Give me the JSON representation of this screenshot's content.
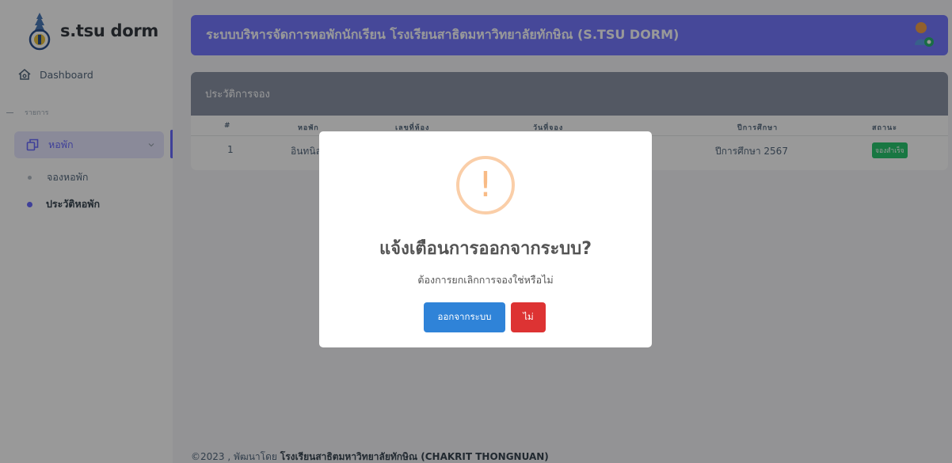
{
  "sidebar": {
    "brand": "s.tsu dorm",
    "dashboard_label": "Dashboard",
    "menu_header": "รายการ",
    "dorm_label": "หอพัก",
    "sub_items": [
      "จองหอพัก",
      "ประวัติหอพัก"
    ]
  },
  "navbar": {
    "title": "ระบบบริหารจัดการหอพักนักเรียน โรงเรียนสาธิตมหาวิทยาลัยทักษิณ (S.TSU DORM)"
  },
  "card": {
    "title": "ประวัติการจอง",
    "columns": [
      "#",
      "หอพัก",
      "เลขที่ห้อง",
      "วันที่จอง",
      "ปีการศึกษา",
      "สถานะ"
    ],
    "rows": [
      {
        "no": "1",
        "dorm": "อินทนิล",
        "room": "",
        "date": "",
        "year": "ปีการศึกษา 2567",
        "status": "จองสำเร็จ"
      }
    ]
  },
  "footer": {
    "prefix": "©2023 , พัฒนาโดย",
    "org": "โรงเรียนสาธิตมหาวิทยาลัยทักษิณ (CHAKRIT THONGNUAN)"
  },
  "modal": {
    "icon_text": "!",
    "title": "แจ้งเตือนการออกจากระบบ?",
    "text": "ต้องการยกเลิกการจองใช่หรือไม่",
    "confirm_label": "ออกจากระบบ",
    "cancel_label": "ไม่"
  },
  "colors": {
    "accent": "#696cff",
    "navbar": "#7579ff",
    "confirm": "#2f83d8",
    "cancel": "#dd3333",
    "success": "#28c76f",
    "warning": "#f8bb86"
  }
}
